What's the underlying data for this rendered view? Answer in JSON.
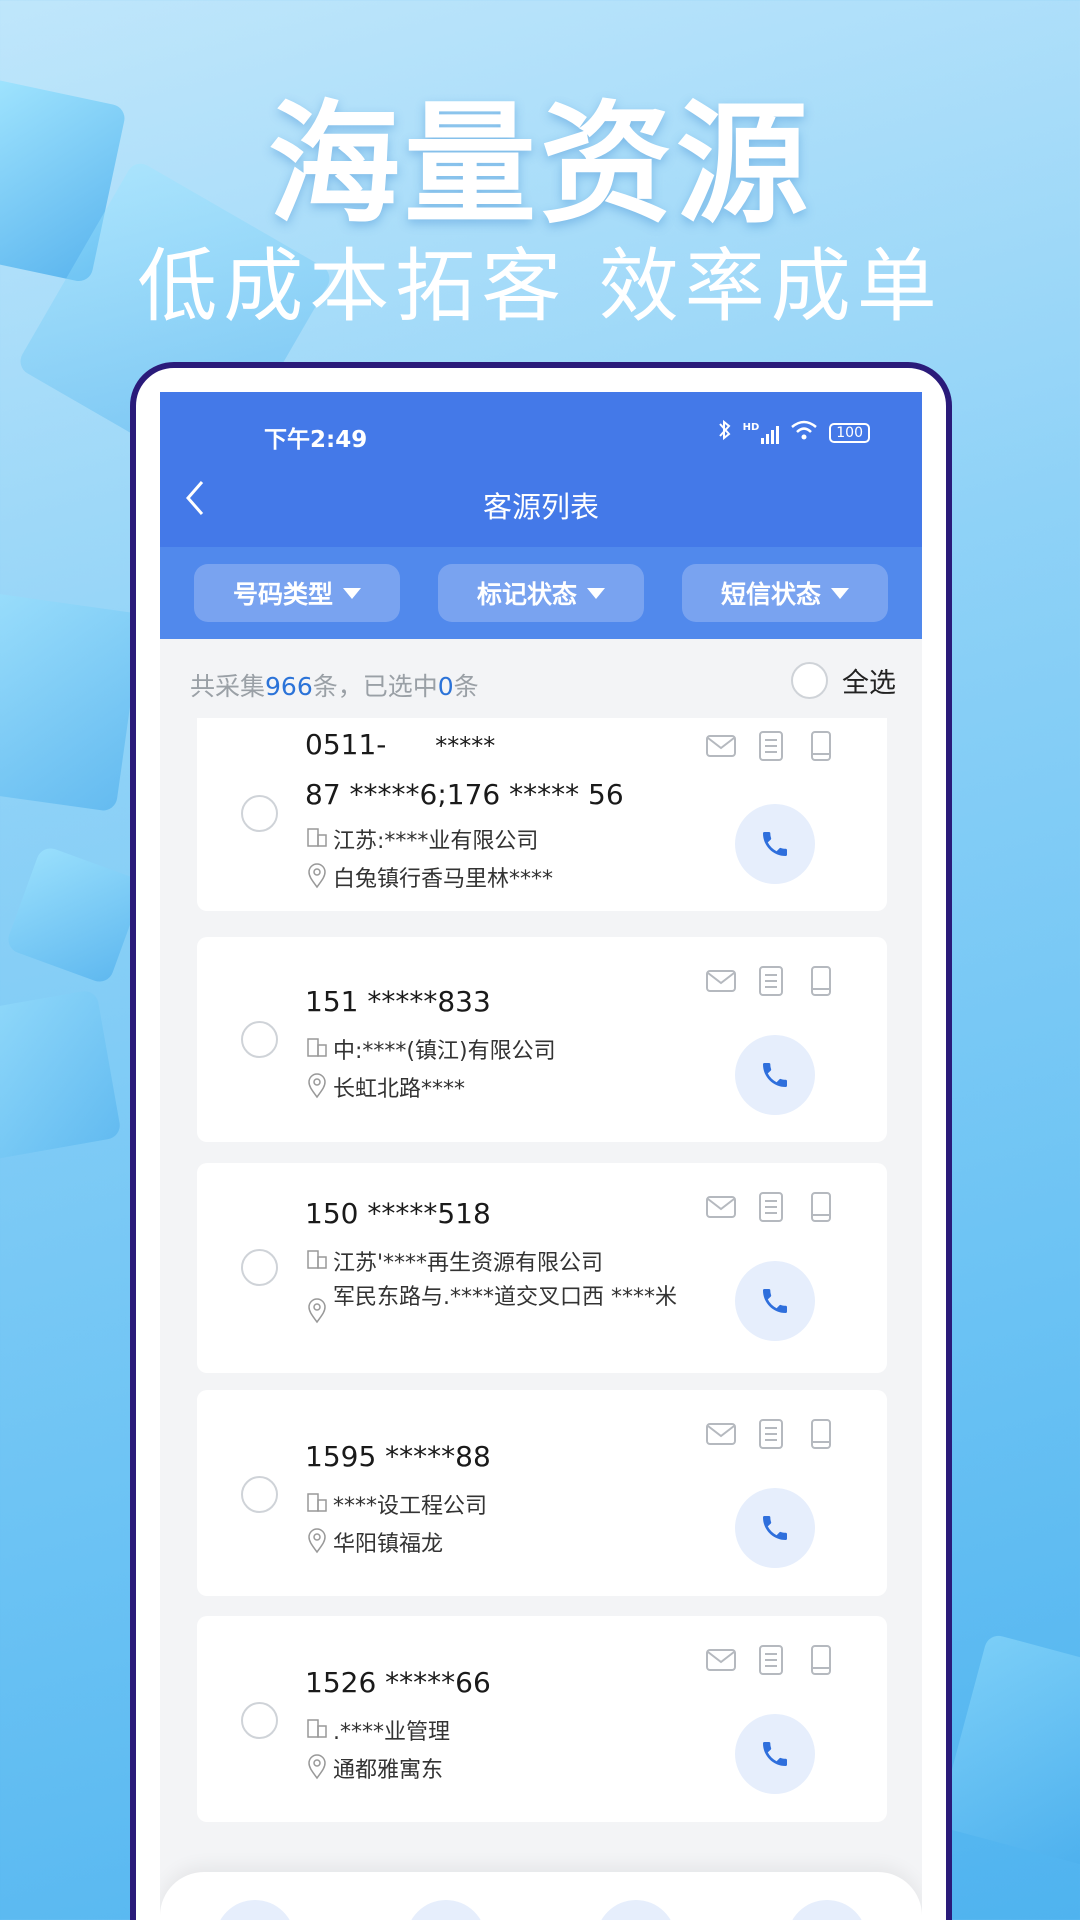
{
  "banner": {
    "headline": "海量资源",
    "subline": "低成本拓客 效率成单"
  },
  "status_bar": {
    "time": "下午2:49",
    "network": "HD",
    "battery": "100"
  },
  "header": {
    "title": "客源列表"
  },
  "filters": [
    {
      "label": "号码类型"
    },
    {
      "label": "标记状态"
    },
    {
      "label": "短信状态"
    }
  ],
  "summary": {
    "prefix": "共采集",
    "total": "966",
    "middle": "条，已选中",
    "selected": "0",
    "suffix": "条",
    "select_all": "全选"
  },
  "contacts": [
    {
      "phone": "0511-",
      "phone_line2": "87 *****6;176  *****  56",
      "phone_partial": "*****",
      "company": "江苏:****业有限公司",
      "address": "白兔镇行香马里林****"
    },
    {
      "phone": "151 *****833",
      "company": "中:****(镇江)有限公司",
      "address": "长虹北路****"
    },
    {
      "phone": "150 *****518",
      "company": "江苏'****再生资源有限公司",
      "address": "军民东路与.****道交叉口西 ****米"
    },
    {
      "phone": "1595 *****88",
      "company": "****设工程公司",
      "address": "华阳镇福龙"
    },
    {
      "phone": "1526 *****66",
      "company": ".****业管理",
      "address": "通都雅寓东"
    }
  ],
  "colors": {
    "accent": "#4479e8",
    "filter_bar": "#5189ec",
    "call_bg": "#e6eefc",
    "call_icon": "#2f6fdc",
    "frame": "#2a1b7a"
  },
  "icons": {
    "card": [
      "envelope-icon",
      "document-icon",
      "mobile-icon"
    ],
    "call": "phone-icon",
    "bottom_nav": [
      "contact-card-icon",
      "clipboard-icon",
      "chat-icon",
      "trash-icon"
    ]
  }
}
